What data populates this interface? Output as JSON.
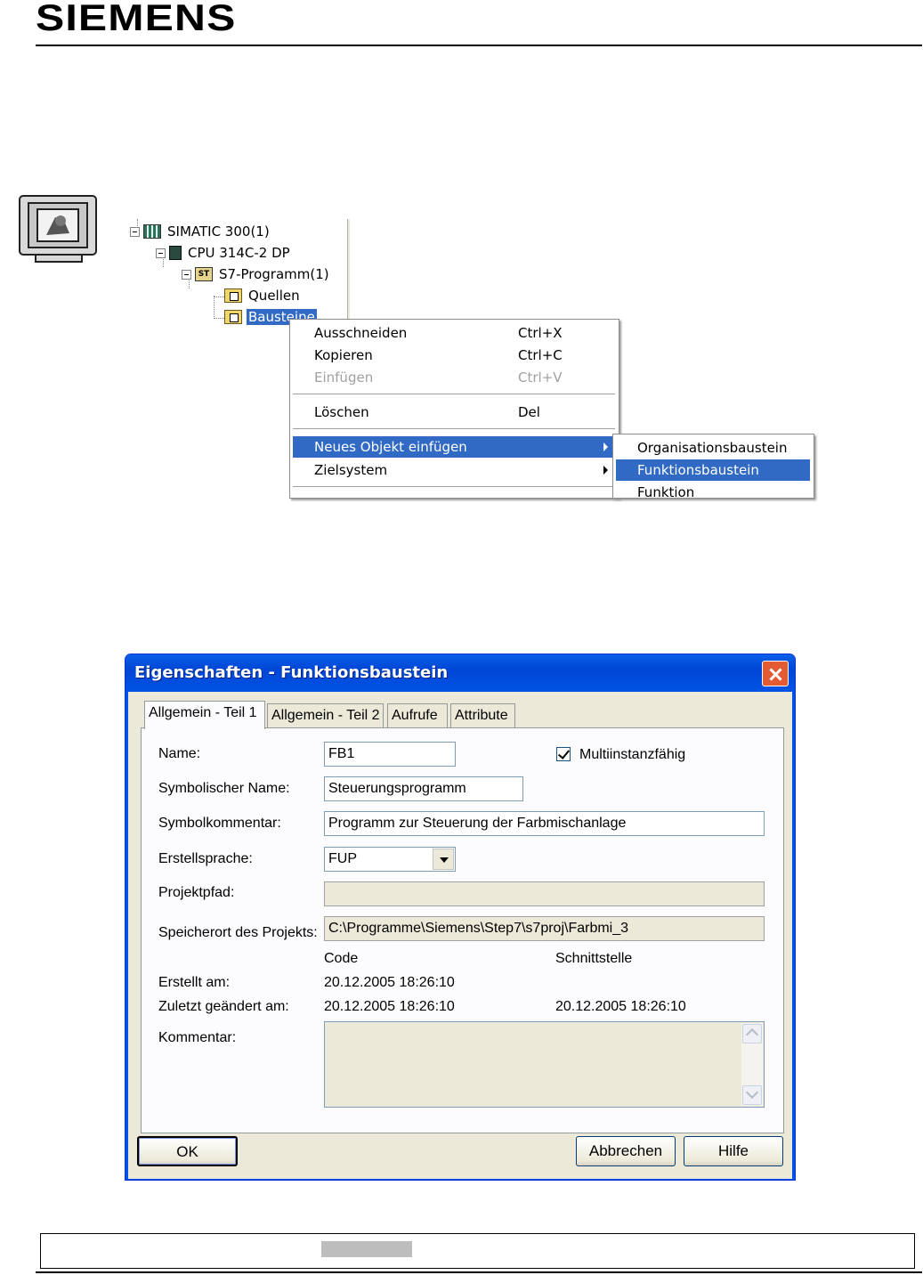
{
  "header": {
    "brand": "SIEMENS"
  },
  "tree": {
    "items": [
      {
        "label": "SIMATIC 300(1)"
      },
      {
        "label": "CPU 314C-2 DP"
      },
      {
        "label": "S7-Programm(1)"
      },
      {
        "label": "Quellen"
      },
      {
        "label": "Bausteine"
      }
    ],
    "s7_icon_text": "ST"
  },
  "context_menu": {
    "items": [
      {
        "label": "Ausschneiden",
        "shortcut": "Ctrl+X"
      },
      {
        "label": "Kopieren",
        "shortcut": "Ctrl+C"
      },
      {
        "label": "Einfügen",
        "shortcut": "Ctrl+V",
        "disabled": true
      },
      {
        "label": "Löschen",
        "shortcut": "Del"
      },
      {
        "label": "Neues Objekt einfügen",
        "highlighted": true
      },
      {
        "label": "Zielsystem"
      }
    ]
  },
  "submenu": {
    "items": [
      {
        "label": "Organisationsbaustein"
      },
      {
        "label": "Funktionsbaustein",
        "highlighted": true
      },
      {
        "label": "Funktion"
      }
    ]
  },
  "dialog": {
    "title": "Eigenschaften - Funktionsbaustein",
    "tabs": [
      {
        "label": "Allgemein - Teil 1",
        "active": true
      },
      {
        "label": "Allgemein - Teil 2"
      },
      {
        "label": "Aufrufe"
      },
      {
        "label": "Attribute"
      }
    ],
    "fields": {
      "name_label": "Name:",
      "name_value": "FB1",
      "multiinstance_label": "Multiinstanzfähig",
      "multiinstance_checked": true,
      "symbolic_name_label": "Symbolischer Name:",
      "symbolic_name_value": "Steuerungsprogramm",
      "symbol_comment_label": "Symbolkommentar:",
      "symbol_comment_value": "Programm zur Steuerung der Farbmischanlage",
      "language_label": "Erstellsprache:",
      "language_value": "FUP",
      "project_path_label": "Projektpfad:",
      "project_path_value": "",
      "storage_label": "Speicherort des Projekts:",
      "storage_value": "C:\\Programme\\Siemens\\Step7\\s7proj\\Farbmi_3",
      "code_header": "Code",
      "interface_header": "Schnittstelle",
      "created_label": "Erstellt am:",
      "created_code": "20.12.2005  18:26:10",
      "modified_label": "Zuletzt geändert am:",
      "modified_code": "20.12.2005  18:26:10",
      "modified_interface": "20.12.2005  18:26:10",
      "comment_label": "Kommentar:",
      "comment_value": ""
    },
    "buttons": {
      "ok": "OK",
      "cancel": "Abbrechen",
      "help": "Hilfe"
    }
  },
  "colors": {
    "selection": "#316ac5",
    "titlebar": "#0054e3",
    "dialog_bg": "#ece9d8"
  }
}
